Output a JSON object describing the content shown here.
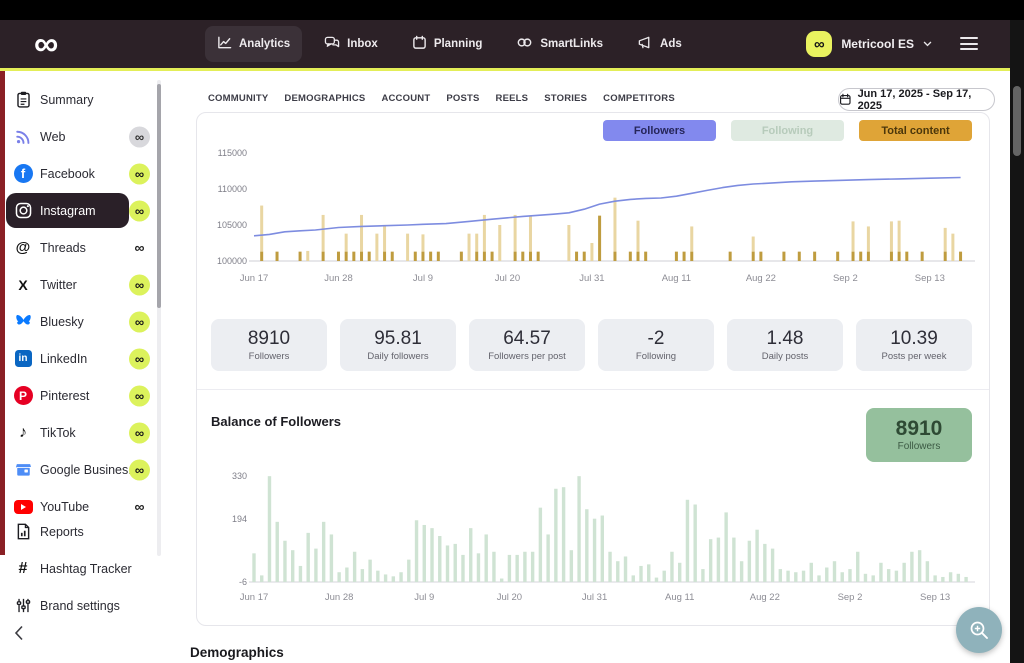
{
  "topbar": {
    "logo_icon": "metricool-infinity",
    "nav": [
      {
        "label": "Analytics",
        "icon": "analytics",
        "active": true
      },
      {
        "label": "Inbox",
        "icon": "inbox",
        "active": false
      },
      {
        "label": "Planning",
        "icon": "planning",
        "active": false
      },
      {
        "label": "SmartLinks",
        "icon": "smartlinks",
        "active": false
      },
      {
        "label": "Ads",
        "icon": "ads",
        "active": false
      }
    ],
    "account_name": "Metricool ES"
  },
  "sidebar": {
    "channels": [
      {
        "label": "Summary",
        "icon": "clipboard",
        "badge": "none",
        "selected": false
      },
      {
        "label": "Web",
        "icon": "web",
        "badge": "gray",
        "selected": false
      },
      {
        "label": "Facebook",
        "icon": "facebook",
        "badge": "lime",
        "selected": false
      },
      {
        "label": "Instagram",
        "icon": "instagram",
        "badge": "lime",
        "selected": true
      },
      {
        "label": "Threads",
        "icon": "threads",
        "badge": "plain",
        "selected": false
      },
      {
        "label": "Twitter",
        "icon": "twitter",
        "badge": "lime",
        "selected": false
      },
      {
        "label": "Bluesky",
        "icon": "bluesky",
        "badge": "lime",
        "selected": false
      },
      {
        "label": "LinkedIn",
        "icon": "linkedin",
        "badge": "lime",
        "selected": false
      },
      {
        "label": "Pinterest",
        "icon": "pinterest",
        "badge": "lime",
        "selected": false
      },
      {
        "label": "TikTok",
        "icon": "tiktok",
        "badge": "lime",
        "selected": false
      },
      {
        "label": "Google Busines...",
        "icon": "google-business",
        "badge": "lime",
        "selected": false
      },
      {
        "label": "YouTube",
        "icon": "youtube",
        "badge": "plain",
        "selected": false
      }
    ],
    "tools": [
      {
        "label": "Reports",
        "icon": "reports"
      },
      {
        "label": "Hashtag Tracker",
        "icon": "hashtag"
      },
      {
        "label": "Brand settings",
        "icon": "sliders"
      }
    ]
  },
  "content": {
    "tabs": [
      "COMMUNITY",
      "DEMOGRAPHICS",
      "ACCOUNT",
      "POSTS",
      "REELS",
      "STORIES",
      "COMPETITORS"
    ],
    "active_tab": "COMMUNITY",
    "date_range": "Jun 17, 2025 - Sep 17, 2025",
    "legend": [
      {
        "label": "Followers",
        "bg": "#8289ee",
        "fg": "#26265a",
        "state": "active"
      },
      {
        "label": "Following",
        "bg": "#dfeae1",
        "fg": "#b7cbbb",
        "state": "disabled"
      },
      {
        "label": "Total content",
        "bg": "#dfa437",
        "fg": "#4c370b",
        "state": "active"
      }
    ],
    "stats": [
      {
        "value": "8910",
        "label": "Followers"
      },
      {
        "value": "95.81",
        "label": "Daily followers"
      },
      {
        "value": "64.57",
        "label": "Followers per post"
      },
      {
        "value": "-2",
        "label": "Following"
      },
      {
        "value": "1.48",
        "label": "Daily posts"
      },
      {
        "value": "10.39",
        "label": "Posts per week"
      }
    ],
    "balance": {
      "title": "Balance of Followers",
      "badge_value": "8910",
      "badge_label": "Followers",
      "badge_bg": "#95c09d"
    },
    "demographics_title": "Demographics"
  },
  "chart_data": [
    {
      "type": "line+bar",
      "name": "Followers evolution with total content",
      "x_labels": [
        "Jun 17",
        "Jun 28",
        "Jul 9",
        "Jul 20",
        "Jul 31",
        "Aug 11",
        "Aug 22",
        "Sep 2",
        "Sep 13"
      ],
      "x_label_days": [
        0,
        11,
        22,
        33,
        44,
        55,
        66,
        77,
        88
      ],
      "days_total": 93,
      "y_ticks": [
        100000,
        105000,
        110000,
        115000
      ],
      "ylim": [
        100000,
        115000
      ],
      "line_series": {
        "name": "Followers",
        "color": "#7d8ce0",
        "points": [
          [
            0,
            103500
          ],
          [
            2,
            103700
          ],
          [
            4,
            104050
          ],
          [
            6,
            104200
          ],
          [
            8,
            104300
          ],
          [
            11,
            104650
          ],
          [
            14,
            104800
          ],
          [
            17,
            104900
          ],
          [
            20,
            105000
          ],
          [
            22,
            105100
          ],
          [
            25,
            105200
          ],
          [
            28,
            105500
          ],
          [
            31,
            105800
          ],
          [
            33,
            106000
          ],
          [
            35,
            106200
          ],
          [
            37,
            106350
          ],
          [
            39,
            106500
          ],
          [
            41,
            106700
          ],
          [
            43,
            107200
          ],
          [
            45,
            107900
          ],
          [
            47,
            108300
          ],
          [
            49,
            108550
          ],
          [
            51,
            108700
          ],
          [
            53,
            108750
          ],
          [
            55,
            109000
          ],
          [
            57,
            109400
          ],
          [
            59,
            109800
          ],
          [
            61,
            110200
          ],
          [
            63,
            110500
          ],
          [
            65,
            110700
          ],
          [
            67,
            110800
          ],
          [
            70,
            111000
          ],
          [
            73,
            111100
          ],
          [
            76,
            111200
          ],
          [
            80,
            111300
          ],
          [
            84,
            111400
          ],
          [
            88,
            111500
          ],
          [
            92,
            111600
          ]
        ]
      },
      "bar_series": {
        "name": "Total content",
        "color_light": "#e9d6a2",
        "color_dark": "#bf9c3f",
        "bars": [
          [
            1,
            7700,
            "s"
          ],
          [
            3,
            1300,
            "d"
          ],
          [
            6,
            1300,
            "d"
          ],
          [
            7,
            1400,
            "l"
          ],
          [
            9,
            6400,
            "s"
          ],
          [
            11,
            1300,
            "d"
          ],
          [
            12,
            3800,
            "s"
          ],
          [
            13,
            1300,
            "d"
          ],
          [
            14,
            6400,
            "s"
          ],
          [
            15,
            1300,
            "d"
          ],
          [
            16,
            3800,
            "l"
          ],
          [
            17,
            5000,
            "s"
          ],
          [
            18,
            1300,
            "d"
          ],
          [
            20,
            3800,
            "l"
          ],
          [
            21,
            1300,
            "d"
          ],
          [
            22,
            3700,
            "s"
          ],
          [
            23,
            1300,
            "d"
          ],
          [
            24,
            1300,
            "d"
          ],
          [
            27,
            1300,
            "d"
          ],
          [
            28,
            3800,
            "l"
          ],
          [
            29,
            3800,
            "s"
          ],
          [
            30,
            6400,
            "s"
          ],
          [
            31,
            1300,
            "d"
          ],
          [
            32,
            5000,
            "l"
          ],
          [
            34,
            6400,
            "s"
          ],
          [
            35,
            1300,
            "d"
          ],
          [
            36,
            6300,
            "s"
          ],
          [
            37,
            1300,
            "d"
          ],
          [
            41,
            5000,
            "l"
          ],
          [
            42,
            1300,
            "d"
          ],
          [
            43,
            1300,
            "d"
          ],
          [
            44,
            2500,
            "l"
          ],
          [
            45,
            6300,
            "d"
          ],
          [
            47,
            8800,
            "s"
          ],
          [
            49,
            1300,
            "d"
          ],
          [
            50,
            5600,
            "s"
          ],
          [
            51,
            1300,
            "d"
          ],
          [
            55,
            1300,
            "d"
          ],
          [
            56,
            1300,
            "d"
          ],
          [
            57,
            4800,
            "s"
          ],
          [
            62,
            1300,
            "d"
          ],
          [
            65,
            3400,
            "s"
          ],
          [
            66,
            1300,
            "d"
          ],
          [
            69,
            1300,
            "d"
          ],
          [
            71,
            1300,
            "d"
          ],
          [
            73,
            1300,
            "d"
          ],
          [
            76,
            1300,
            "d"
          ],
          [
            78,
            5500,
            "s"
          ],
          [
            79,
            1300,
            "d"
          ],
          [
            80,
            4800,
            "s"
          ],
          [
            83,
            5500,
            "s"
          ],
          [
            84,
            5600,
            "s"
          ],
          [
            85,
            1300,
            "d"
          ],
          [
            87,
            1300,
            "d"
          ],
          [
            90,
            4600,
            "s"
          ],
          [
            91,
            3800,
            "l"
          ],
          [
            92,
            1300,
            "d"
          ]
        ]
      },
      "disabled_series": [
        "Following"
      ]
    },
    {
      "type": "bar",
      "name": "Balance of Followers",
      "x_labels": [
        "Jun 17",
        "Jun 28",
        "Jul 9",
        "Jul 20",
        "Jul 31",
        "Aug 11",
        "Aug 22",
        "Sep 2",
        "Sep 13"
      ],
      "x_label_days": [
        0,
        11,
        22,
        33,
        44,
        55,
        66,
        77,
        88
      ],
      "days_total": 93,
      "y_ticks": [
        330,
        194,
        -6
      ],
      "ylim": [
        -6,
        330
      ],
      "color": "#cfe3d3",
      "values": [
        85,
        15,
        330,
        185,
        125,
        95,
        45,
        150,
        100,
        185,
        145,
        25,
        40,
        90,
        35,
        65,
        30,
        18,
        12,
        25,
        65,
        190,
        175,
        165,
        140,
        110,
        115,
        80,
        165,
        85,
        145,
        90,
        5,
        80,
        80,
        90,
        90,
        230,
        145,
        290,
        295,
        95,
        330,
        225,
        195,
        205,
        90,
        60,
        75,
        15,
        45,
        50,
        8,
        30,
        90,
        55,
        255,
        240,
        35,
        130,
        135,
        215,
        135,
        60,
        125,
        160,
        115,
        100,
        35,
        30,
        25,
        30,
        55,
        15,
        40,
        60,
        25,
        35,
        90,
        20,
        15,
        55,
        35,
        30,
        55,
        90,
        95,
        60,
        15,
        10,
        25,
        20,
        10
      ]
    }
  ]
}
